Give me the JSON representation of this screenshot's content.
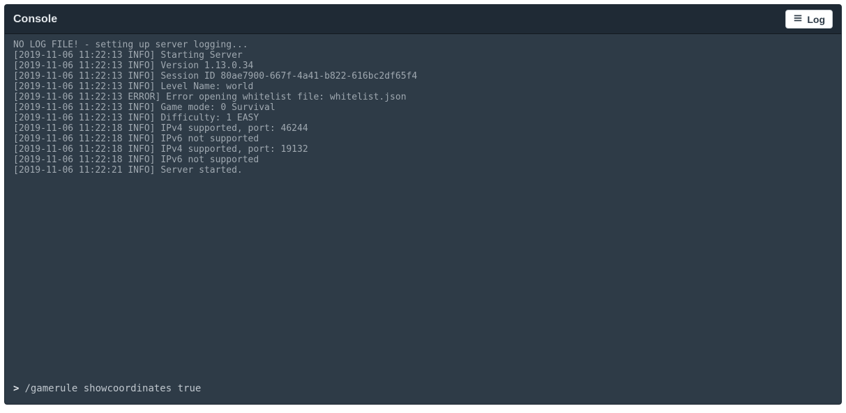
{
  "header": {
    "title": "Console",
    "log_button_label": "Log"
  },
  "console": {
    "lines": [
      "NO LOG FILE! - setting up server logging...",
      "[2019-11-06 11:22:13 INFO] Starting Server",
      "[2019-11-06 11:22:13 INFO] Version 1.13.0.34",
      "[2019-11-06 11:22:13 INFO] Session ID 80ae7900-667f-4a41-b822-616bc2df65f4",
      "[2019-11-06 11:22:13 INFO] Level Name: world",
      "[2019-11-06 11:22:13 ERROR] Error opening whitelist file: whitelist.json",
      "[2019-11-06 11:22:13 INFO] Game mode: 0 Survival",
      "[2019-11-06 11:22:13 INFO] Difficulty: 1 EASY",
      "[2019-11-06 11:22:18 INFO] IPv4 supported, port: 46244",
      "[2019-11-06 11:22:18 INFO] IPv6 not supported",
      "[2019-11-06 11:22:18 INFO] IPv4 supported, port: 19132",
      "[2019-11-06 11:22:18 INFO] IPv6 not supported",
      "[2019-11-06 11:22:21 INFO] Server started."
    ],
    "prompt": ">",
    "input_value": "/gamerule showcoordinates true"
  },
  "colors": {
    "panel_bg": "#2e3b47",
    "header_bg": "#1f2a35",
    "text_muted": "#9fa8b0",
    "text_light": "#e2e6ea"
  }
}
